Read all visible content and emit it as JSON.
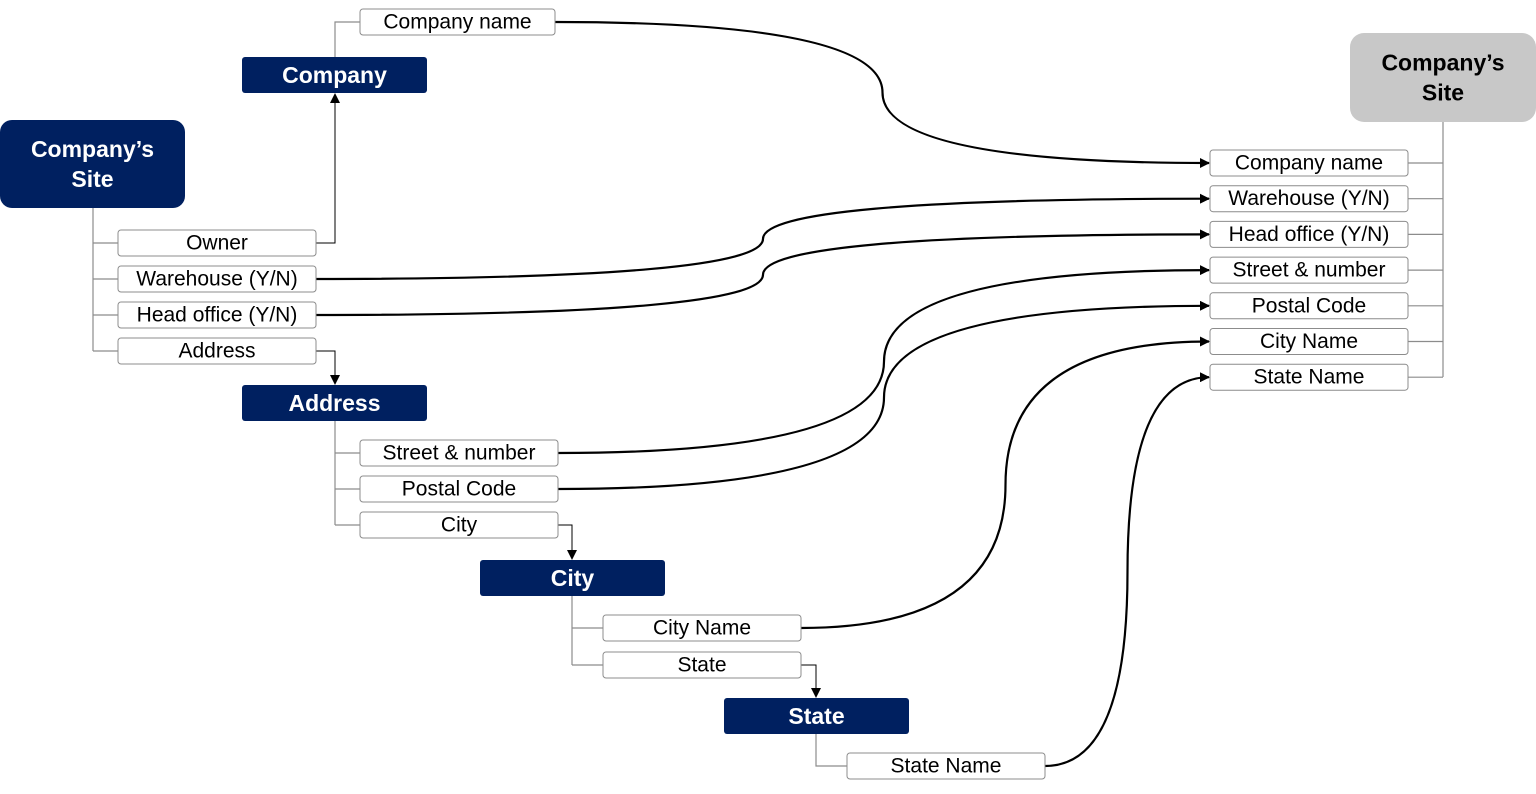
{
  "colors": {
    "entity": "#002060",
    "target_entity": "#c8c8c8",
    "entity_text": "#ffffff",
    "target_text": "#000000"
  },
  "source": {
    "site": {
      "title": [
        "Company’s",
        "Site"
      ],
      "fields": [
        "Owner",
        "Warehouse (Y/N)",
        "Head office (Y/N)",
        "Address"
      ]
    },
    "company": {
      "title": "Company",
      "fields": [
        "Company name"
      ]
    },
    "address": {
      "title": "Address",
      "fields": [
        "Street & number",
        "Postal Code",
        "City"
      ]
    },
    "city": {
      "title": "City",
      "fields": [
        "City Name",
        "State"
      ]
    },
    "state": {
      "title": "State",
      "fields": [
        "State Name"
      ]
    }
  },
  "target": {
    "title": [
      "Company’s",
      "Site"
    ],
    "fields": [
      "Company name",
      "Warehouse (Y/N)",
      "Head office (Y/N)",
      "Street & number",
      "Postal Code",
      "City Name",
      "State Name"
    ]
  },
  "mappings": [
    {
      "from": "Company name",
      "to": "Company name"
    },
    {
      "from": "Warehouse (Y/N)",
      "to": "Warehouse (Y/N)"
    },
    {
      "from": "Head office (Y/N)",
      "to": "Head office (Y/N)"
    },
    {
      "from": "Street & number",
      "to": "Street & number"
    },
    {
      "from": "Postal Code",
      "to": "Postal Code"
    },
    {
      "from": "City Name",
      "to": "City Name"
    },
    {
      "from": "State Name",
      "to": "State Name"
    }
  ]
}
